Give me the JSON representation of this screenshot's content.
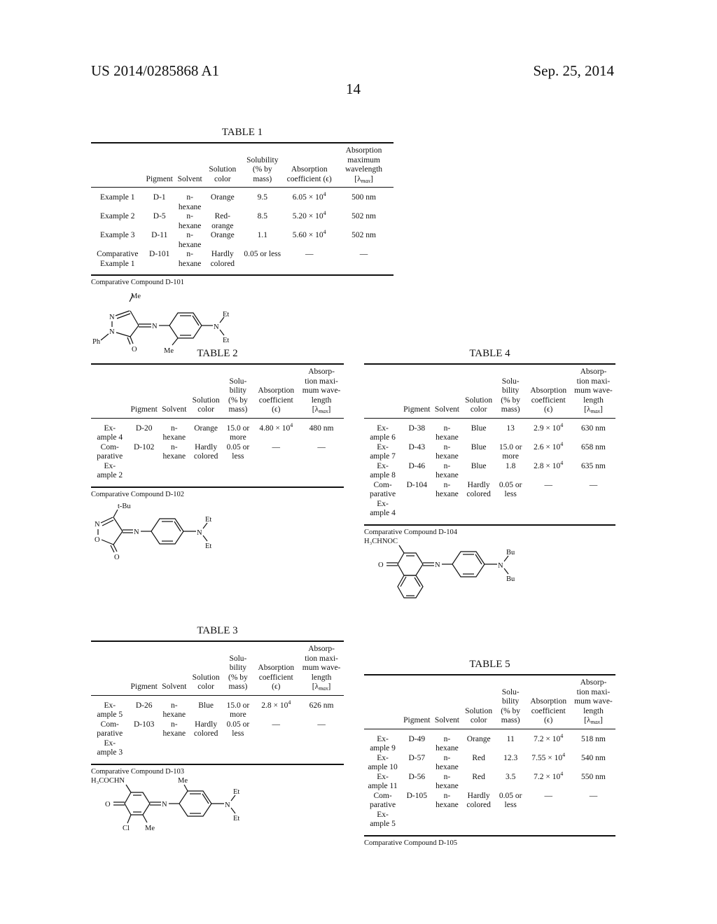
{
  "header": {
    "patent_number": "US 2014/0285868 A1",
    "date": "Sep. 25, 2014",
    "page_number": "14"
  },
  "columns": {
    "example": "",
    "pigment": "Pigment",
    "solvent": "Solvent",
    "solution_color": "Solution color",
    "solubility": "Solubility (% by mass)",
    "absorption_coefficient": "Absorption coefficient (ϵ)",
    "absorption_max_prefix": "Absorption maximum wavelength [λ",
    "absorption_max_sub": "max",
    "absorption_max_suffix": "]"
  },
  "columns_narrow": {
    "solution_color": "Solution color",
    "solubility": "Solu- bility (% by mass)",
    "absorption_coefficient": "Absorption coefficient (ϵ)",
    "absorption_max_prefix": "Absorp- tion maxi- mum wave- length [λ"
  },
  "tables": [
    {
      "title": "TABLE 1",
      "rows": [
        {
          "example": "Example 1",
          "pigment": "D-1",
          "solvent": "n-hexane",
          "color": "Orange",
          "solubility": "9.5",
          "coef_mantissa": "6.05",
          "coef_exp": "4",
          "wavelength": "500 nm"
        },
        {
          "example": "Example 2",
          "pigment": "D-5",
          "solvent": "n-hexane",
          "color": "Red-orange",
          "solubility": "8.5",
          "coef_mantissa": "5.20",
          "coef_exp": "4",
          "wavelength": "502 nm"
        },
        {
          "example": "Example 3",
          "pigment": "D-11",
          "solvent": "n-hexane",
          "color": "Orange",
          "solubility": "1.1",
          "coef_mantissa": "5.60",
          "coef_exp": "4",
          "wavelength": "502 nm"
        },
        {
          "example": "Comparative Example 1",
          "pigment": "D-101",
          "solvent": "n-hexane",
          "color": "Hardly colored",
          "solubility": "0.05 or less",
          "coef": "—",
          "wavelength": "—"
        }
      ],
      "compound_caption": "Comparative Compound D-101",
      "compound_labels": {
        "me_top": "Me",
        "n1": "N",
        "n2": "N",
        "ph": "Ph",
        "o": "O",
        "imine_n": "N",
        "me_bottom": "Me",
        "amine_n": "N",
        "et1": "Et",
        "et2": "Et"
      }
    },
    {
      "title": "TABLE 2",
      "rows": [
        {
          "example": "Ex- ample 4",
          "pigment": "D-20",
          "solvent": "n-hexane",
          "color": "Orange",
          "solubility": "15.0 or more",
          "coef_mantissa": "4.80",
          "coef_exp": "4",
          "wavelength": "480 nm"
        },
        {
          "example": "Com- parative Ex- ample 2",
          "pigment": "D-102",
          "solvent": "n-hexane",
          "color": "Hardly colored",
          "solubility": "0.05 or less",
          "coef": "—",
          "wavelength": "—"
        }
      ],
      "compound_caption": "Comparative Compound D-102",
      "compound_labels": {
        "tbu": "t-Bu",
        "n": "N",
        "o_ring": "O",
        "o": "O",
        "imine_n": "N",
        "amine_n": "N",
        "et1": "Et",
        "et2": "Et"
      }
    },
    {
      "title": "TABLE 3",
      "rows": [
        {
          "example": "Ex- ample 5",
          "pigment": "D-26",
          "solvent": "n-hexane",
          "color": "Blue",
          "solubility": "15.0 or more",
          "coef_mantissa": "2.8",
          "coef_exp": "4",
          "wavelength": "626 nm"
        },
        {
          "example": "Com- parative Ex- ample 3",
          "pigment": "D-103",
          "solvent": "n-hexane",
          "color": "Hardly colored",
          "solubility": "0.05 or less",
          "coef": "—",
          "wavelength": "—"
        }
      ],
      "compound_caption": "Comparative Compound D-103",
      "compound_labels": {
        "acyl": "H₃COCHN",
        "o": "O",
        "cl": "Cl",
        "me_ring": "Me",
        "imine_n": "N",
        "me_top": "Me",
        "amine_n": "N",
        "et1": "Et",
        "et2": "Et"
      }
    },
    {
      "title": "TABLE 4",
      "rows": [
        {
          "example": "Ex- ample 6",
          "pigment": "D-38",
          "solvent": "n-hexane",
          "color": "Blue",
          "solubility": "13",
          "coef_mantissa": "2.9",
          "coef_exp": "4",
          "wavelength": "630 nm"
        },
        {
          "example": "Ex- ample 7",
          "pigment": "D-43",
          "solvent": "n-hexane",
          "color": "Blue",
          "solubility": "15.0 or more",
          "coef_mantissa": "2.6",
          "coef_exp": "4",
          "wavelength": "658 nm"
        },
        {
          "example": "Ex- ample 8",
          "pigment": "D-46",
          "solvent": "n-hexane",
          "color": "Blue",
          "solubility": "1.8",
          "coef_mantissa": "2.8",
          "coef_exp": "4",
          "wavelength": "635 nm"
        },
        {
          "example": "Com- parative Ex- ample 4",
          "pigment": "D-104",
          "solvent": "n-hexane",
          "color": "Hardly colored",
          "solubility": "0.05 or less",
          "coef": "—",
          "wavelength": "—"
        }
      ],
      "compound_caption": "Comparative Compound D-104",
      "compound_labels": {
        "acyl": "H₃CHNOC",
        "o": "O",
        "imine_n": "N",
        "amine_n": "N",
        "bu1": "Bu",
        "bu2": "Bu"
      }
    },
    {
      "title": "TABLE 5",
      "rows": [
        {
          "example": "Ex- ample 9",
          "pigment": "D-49",
          "solvent": "n-hexane",
          "color": "Orange",
          "solubility": "11",
          "coef_mantissa": "7.2",
          "coef_exp": "4",
          "wavelength": "518 nm"
        },
        {
          "example": "Ex- ample 10",
          "pigment": "D-57",
          "solvent": "n-hexane",
          "color": "Red",
          "solubility": "12.3",
          "coef_mantissa": "7.55",
          "coef_exp": "4",
          "wavelength": "540 nm"
        },
        {
          "example": "Ex- ample 11",
          "pigment": "D-56",
          "solvent": "n-hexane",
          "color": "Red",
          "solubility": "3.5",
          "coef_mantissa": "7.2",
          "coef_exp": "4",
          "wavelength": "550 nm"
        },
        {
          "example": "Com- parative Ex- ample 5",
          "pigment": "D-105",
          "solvent": "n-hexane",
          "color": "Hardly colored",
          "solubility": "0.05 or less",
          "coef": "—",
          "wavelength": "—"
        }
      ],
      "compound_caption": "Comparative Compound D-105"
    }
  ],
  "times_symbol": "× 10"
}
